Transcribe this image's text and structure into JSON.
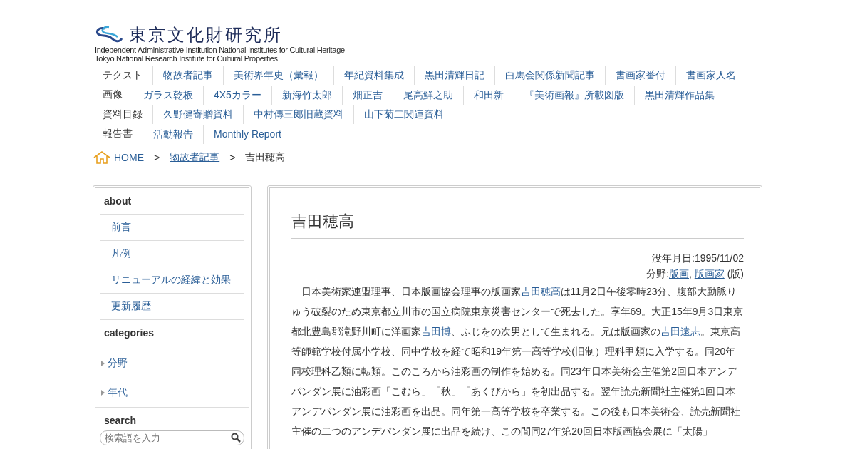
{
  "logo": {
    "title": "東京文化財研究所",
    "subtitle_lines": [
      "Independent Administrative Institution National Institutes for Cultural Heritage",
      "Tokyo National Research Institute for Cultural Properties"
    ]
  },
  "nav": [
    {
      "label": "テクスト",
      "links": [
        "物故者記事",
        "美術界年史（彙報）",
        "年紀資料集成",
        "黒田清輝日記",
        "白馬会関係新聞記事",
        "書画家番付",
        "書画家人名"
      ]
    },
    {
      "label": "画像",
      "links": [
        "ガラス乾板",
        "4X5カラー",
        "新海竹太郎",
        "畑正吉",
        "尾高鮮之助",
        "和田新",
        "『美術画報』所載図版",
        "黒田清輝作品集"
      ]
    },
    {
      "label": "資料目録",
      "links": [
        "久野健寄贈資料",
        "中村傳三郎旧蔵資料",
        "山下菊二関連資料"
      ]
    },
    {
      "label": "報告書",
      "links": [
        "活動報告",
        "Monthly Report"
      ]
    }
  ],
  "breadcrumb": [
    {
      "text": "HOME",
      "kind": "link"
    },
    {
      "text": ">",
      "kind": "separator"
    },
    {
      "text": "物故者記事",
      "kind": "link"
    },
    {
      "text": ">",
      "kind": "separator"
    },
    {
      "text": "吉田穂高",
      "kind": "current"
    }
  ],
  "sidebar": {
    "sections": [
      {
        "heading": "about",
        "kind": "links",
        "items": [
          {
            "label": "前言"
          },
          {
            "label": "凡例"
          },
          {
            "label": "リニューアルの経緯と効果"
          },
          {
            "label": "更新履歴"
          }
        ]
      },
      {
        "heading": "categories",
        "kind": "toggles",
        "items": [
          {
            "label": "分野",
            "expanded": false
          },
          {
            "label": "年代",
            "expanded": false
          }
        ]
      },
      {
        "heading": "search",
        "kind": "search",
        "placeholder": "検索語を入力"
      }
    ]
  },
  "article": {
    "title": "吉田穂高",
    "death_date": "没年月日:1995/11/02",
    "field": [
      {
        "text": "分野:",
        "kind": "text"
      },
      {
        "text": "版画",
        "kind": "link"
      },
      {
        "text": ", ",
        "kind": "text"
      },
      {
        "text": "版画家",
        "kind": "link"
      },
      {
        "text": " (版)",
        "kind": "text"
      }
    ],
    "body": [
      {
        "text": "日本美術家連盟理事、日本版画協会理事の版画家",
        "kind": "text"
      },
      {
        "text": "吉田穂高",
        "kind": "link"
      },
      {
        "text": "は11月2日午後零時23分、腹部大動脈りゅう破裂のため東京都立川市の国立病院東京災害センターで死去した。享年69。大正15年9月3日東京都北豊島郡滝野川町に洋画家",
        "kind": "text"
      },
      {
        "text": "吉田博",
        "kind": "link"
      },
      {
        "text": "、ふじをの次男として生まれる。兄は版画家の",
        "kind": "text"
      },
      {
        "text": "吉田遠志",
        "kind": "link"
      },
      {
        "text": "。東京高等師範学校付属小学校、同中学校を経て昭和19年第一高等学校(旧制）理科甲類に入学する。同20年同校理科乙類に転類。このころから油彩画の制作を始める。同23年日本美術会主催第2回日本アンデパンダン展に油彩画「こむら」「秋」「あくびから」を初出品する。翌年読売新聞社主催第1回日本アンデパンダン展に油彩画を出品。同年第一高等学校を卒業する。この後も日本美術会、読売新聞社主催の二つのアンデパンダン展に出品を続け、この間同27年第20回日本版画協会展に「太陽」",
        "kind": "text"
      }
    ]
  }
}
